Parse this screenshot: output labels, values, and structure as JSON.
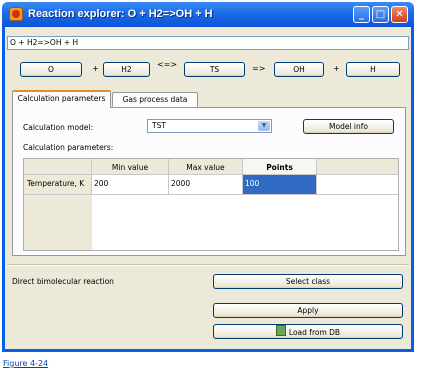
{
  "window": {
    "title": "Reaction explorer: O + H2=>OH + H",
    "minimize_glyph": "_",
    "maximize_glyph": "□",
    "close_glyph": "✕"
  },
  "reaction_input": "O + H2=>OH + H",
  "species": {
    "reactant1": "O",
    "plus1": "+",
    "reactant2": "H2",
    "arrow_equilibrium": "<=>",
    "transition_state": "TS",
    "arrow_forward": "=>",
    "product1": "OH",
    "plus2": "+",
    "product2": "H"
  },
  "tabs": [
    {
      "label": "Calculation parameters",
      "active": true
    },
    {
      "label": "Gas process data",
      "active": false
    }
  ],
  "calc": {
    "model_label": "Calculation model:",
    "model_value": "TST",
    "model_info_button": "Model info",
    "params_label": "Calculation parameters:"
  },
  "grid": {
    "headers": [
      "",
      "Min value",
      "Max value",
      "Points"
    ],
    "rows": [
      {
        "name": "Temperature, K",
        "min": "200",
        "max": "2000",
        "points": "100"
      }
    ]
  },
  "reaction_class": "Direct bimolecular reaction",
  "buttons": {
    "select_class": "Select class",
    "apply": "Apply",
    "load_from_db": "Load from DB"
  },
  "caption": "Figure 4-24",
  "icons": {
    "app": "reaction-app-icon",
    "dropdown": "chevron-down-icon",
    "db": "database-icon"
  }
}
